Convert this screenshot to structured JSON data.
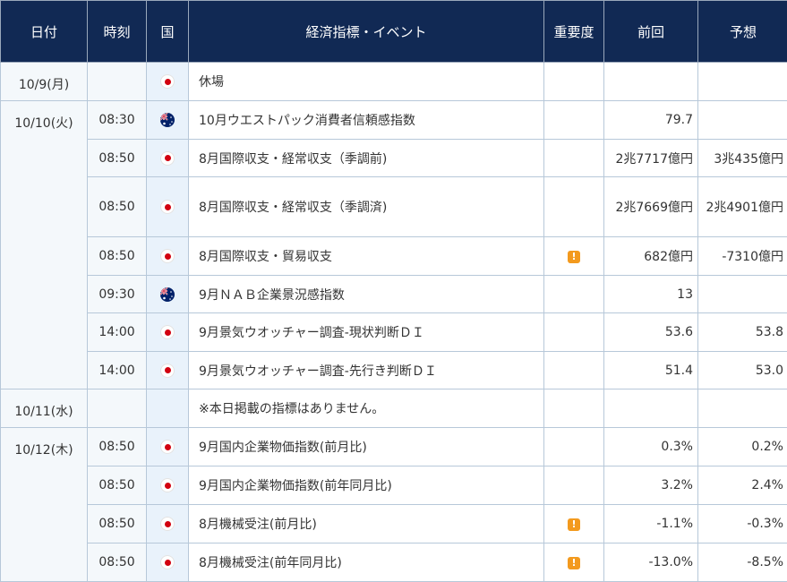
{
  "header": {
    "date": "日付",
    "time": "時刻",
    "country": "国",
    "event": "経済指標・イベント",
    "importance": "重要度",
    "previous": "前回",
    "forecast": "予想"
  },
  "colors": {
    "header_bg": "#112954",
    "accent_warning": "#f39a1e",
    "jp_red": "#d2000f"
  },
  "rows": [
    {
      "date": "10/9(月)",
      "time": "",
      "flag": "jp",
      "event": "休場",
      "important": false,
      "previous": "",
      "forecast": ""
    },
    {
      "date": "10/10(火)",
      "time": "08:30",
      "flag": "au",
      "event": "10月ウエストパック消費者信頼感指数",
      "important": false,
      "previous": "79.7",
      "forecast": ""
    },
    {
      "date": "",
      "time": "08:50",
      "flag": "jp",
      "event": "8月国際収支・経常収支（季調前)",
      "important": false,
      "previous": "2兆7717億円",
      "forecast": "3兆435億円"
    },
    {
      "date": "",
      "time": "08:50",
      "flag": "jp",
      "event": "8月国際収支・経常収支（季調済)",
      "important": false,
      "previous": "2兆7669億円",
      "forecast": "2兆4901億円"
    },
    {
      "date": "",
      "time": "08:50",
      "flag": "jp",
      "event": "8月国際収支・貿易収支",
      "important": true,
      "previous": "682億円",
      "forecast": "-7310億円"
    },
    {
      "date": "",
      "time": "09:30",
      "flag": "au",
      "event": "9月ＮＡＢ企業景況感指数",
      "important": false,
      "previous": "13",
      "forecast": ""
    },
    {
      "date": "",
      "time": "14:00",
      "flag": "jp",
      "event": "9月景気ウオッチャー調査-現状判断ＤＩ",
      "important": false,
      "previous": "53.6",
      "forecast": "53.8"
    },
    {
      "date": "",
      "time": "14:00",
      "flag": "jp",
      "event": "9月景気ウオッチャー調査-先行き判断ＤＩ",
      "important": false,
      "previous": "51.4",
      "forecast": "53.0"
    },
    {
      "date": "10/11(水)",
      "time": "",
      "flag": "",
      "event": "※本日掲載の指標はありません。",
      "important": false,
      "previous": "",
      "forecast": ""
    },
    {
      "date": "10/12(木)",
      "time": "08:50",
      "flag": "jp",
      "event": "9月国内企業物価指数(前月比)",
      "important": false,
      "previous": "0.3%",
      "forecast": "0.2%"
    },
    {
      "date": "",
      "time": "08:50",
      "flag": "jp",
      "event": "9月国内企業物価指数(前年同月比)",
      "important": false,
      "previous": "3.2%",
      "forecast": "2.4%"
    },
    {
      "date": "",
      "time": "08:50",
      "flag": "jp",
      "event": "8月機械受注(前月比)",
      "important": true,
      "previous": "-1.1%",
      "forecast": "-0.3%"
    },
    {
      "date": "",
      "time": "08:50",
      "flag": "jp",
      "event": "8月機械受注(前年同月比)",
      "important": true,
      "previous": "-13.0%",
      "forecast": "-8.5%"
    }
  ]
}
